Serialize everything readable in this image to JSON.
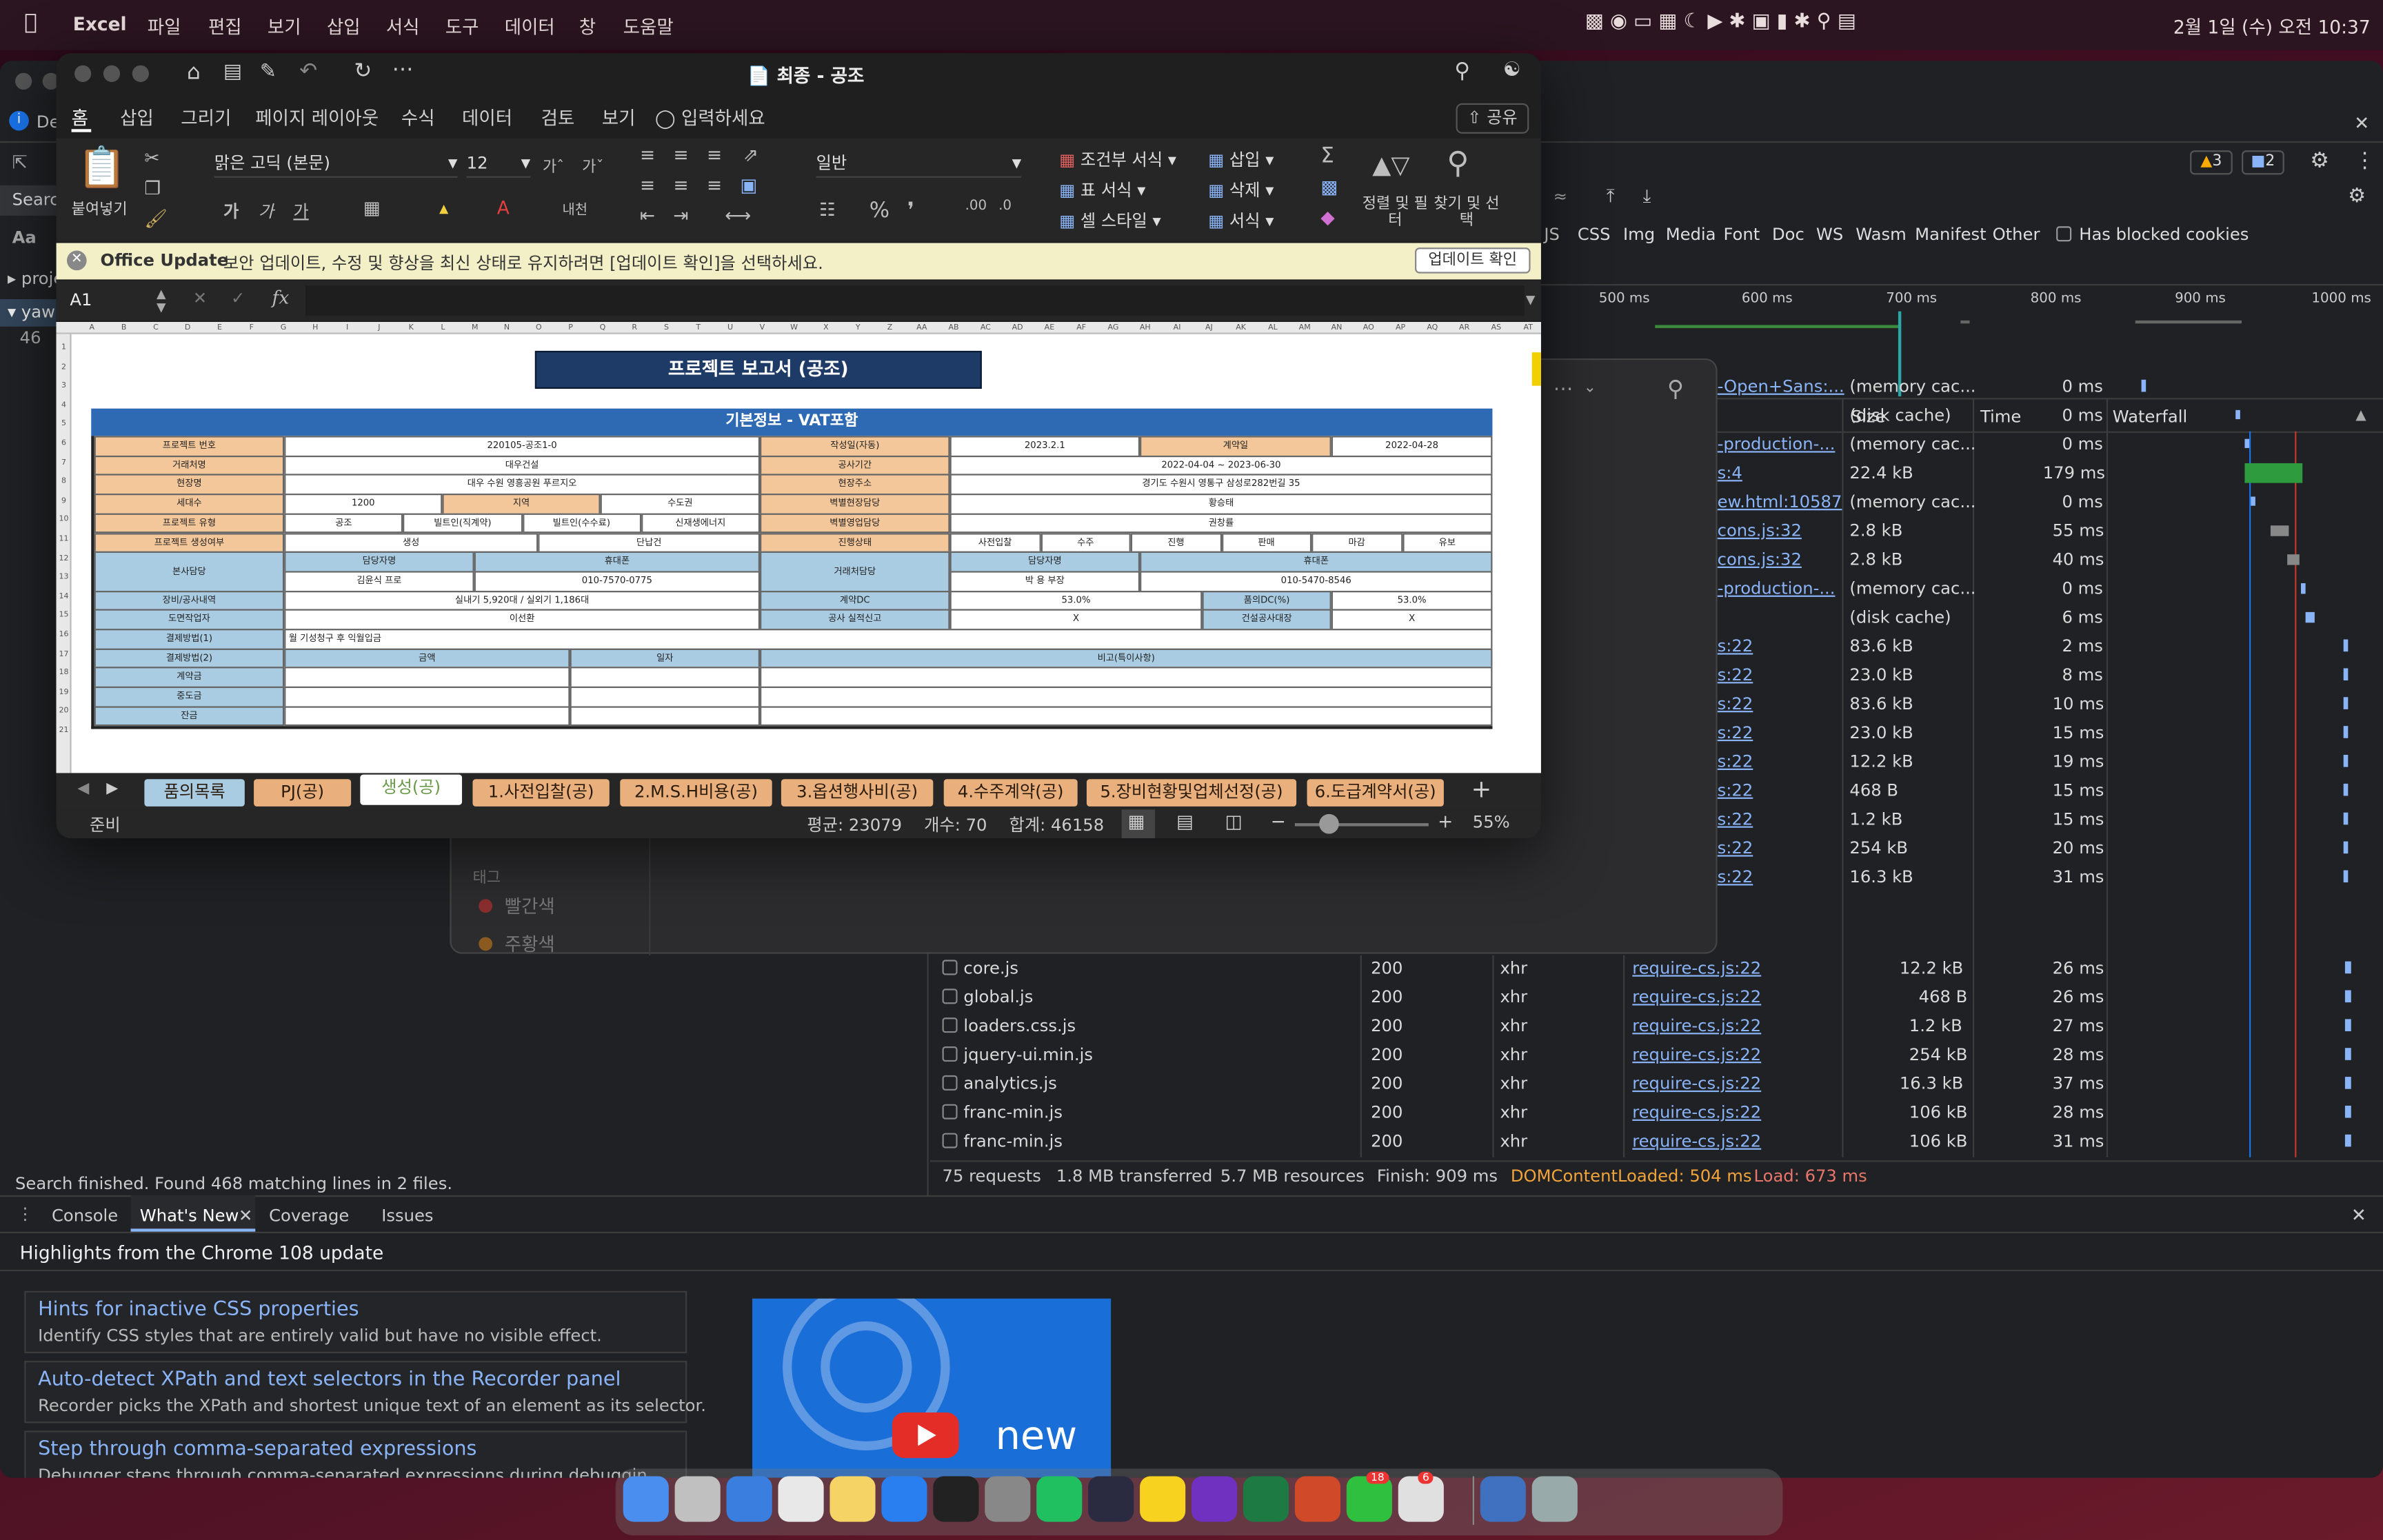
{
  "menubar": {
    "app": "Excel",
    "items": [
      "파일",
      "편집",
      "보기",
      "삽입",
      "서식",
      "도구",
      "데이터",
      "창",
      "도움말"
    ],
    "datetime": "2월 1일 (수) 오전 10:37"
  },
  "excel": {
    "title": "최종 - 공조",
    "share": "공유",
    "ribbon_tabs": [
      "홈",
      "삽입",
      "그리기",
      "페이지 레이아웃",
      "수식",
      "데이터",
      "검토",
      "보기"
    ],
    "tell_me": "입력하세요",
    "paste": "붙여넣기",
    "font_name": "맑은 고딕 (본문)",
    "font_size": "12",
    "number_format": "일반",
    "cond_format": "조건부 서식",
    "table_format": "표 서식",
    "cell_style": "셀 스타일",
    "insert": "삽입",
    "delete": "삭제",
    "format": "서식",
    "sort_filter": "정렬 및 필터",
    "find_select": "찾기 및 선택",
    "update_label": "Office Update",
    "update_msg": "보안 업데이트, 수정 및 향상을 최신 상태로 유지하려면 [업데이트 확인]을 선택하세요.",
    "update_button": "업데이트 확인",
    "name_box": "A1",
    "fx": "fx",
    "columns": [
      "A",
      "B",
      "C",
      "D",
      "E",
      "F",
      "G",
      "H",
      "I",
      "J",
      "K",
      "L",
      "M",
      "N",
      "O",
      "P",
      "Q",
      "R",
      "S",
      "T",
      "U",
      "V",
      "W",
      "X",
      "Y",
      "Z",
      "AA",
      "AB",
      "AC",
      "AD",
      "AE",
      "AF",
      "AG",
      "AH",
      "AI",
      "AJ",
      "AK",
      "AL",
      "AM",
      "AN",
      "AO",
      "AP",
      "AQ",
      "AR",
      "AS",
      "AT"
    ],
    "rows": [
      "1",
      "2",
      "3",
      "4",
      "5",
      "6",
      "7",
      "8",
      "9",
      "10",
      "11",
      "12",
      "13",
      "14",
      "15",
      "16",
      "17",
      "18",
      "19",
      "20",
      "21"
    ],
    "sheet_tabs": [
      "품의목록",
      "PJ(공)",
      "생성(공)",
      "1.사전입찰(공)",
      "2.M.S.H비용(공)",
      "3.옵션행사비(공)",
      "4.수주계약(공)",
      "5.장비현황및업체선정(공)",
      "6.도급계약서(공)"
    ],
    "status_ready": "준비",
    "status_avg": "평균: 23079",
    "status_count": "개수: 70",
    "status_sum": "합계: 46158",
    "zoom": "55%"
  },
  "report": {
    "title": "프로젝트 보고서 (공조)",
    "section": "기본정보 - VAT포함",
    "project_no_label": "프로젝트 번호",
    "project_no": "220105-공조1-0",
    "created_label": "작성일(자동)",
    "created": "2023.2.1",
    "contract_day_label": "계약일",
    "contract_day": "2022-04-28",
    "client_label": "거래처명",
    "client": "대우건설",
    "period_label": "공사기간",
    "period": "2022-04-04 ~ 2023-06-30",
    "site_label": "현장명",
    "site": "대우 수원 영흥공원 푸르지오",
    "address_label": "현장주소",
    "address": "경기도 수원시 영통구 삼성로282번길 35",
    "units_label": "세대수",
    "units": "1200",
    "region_label": "지역",
    "region": "수도권",
    "site_mgr_label": "벽별현장담당",
    "site_mgr": "황승태",
    "sales_mgr_label": "벽별영업담당",
    "sales_mgr": "권창률",
    "ptype_label": "프로젝트 유형",
    "ptype": [
      "공조",
      "빌트인(직계약)",
      "빌트인(수수료)",
      "신재생에너지"
    ],
    "progress_label": "진행상태",
    "progress": [
      "사전입찰",
      "수주",
      "진행",
      "판매",
      "마감",
      "유보"
    ],
    "pcreate_label": "프로젝트 생성여부",
    "pcreate": [
      "생성",
      "단납건"
    ],
    "hq_label": "본사담당",
    "hq_person_h": "담당자명",
    "hq_phone_h": "휴대폰",
    "hq_person": "김윤식 프로",
    "hq_phone": "010-7570-0775",
    "cl_label": "거래처담당",
    "cl_person_h": "담당자명",
    "cl_phone_h": "휴대폰",
    "cl_person": "박 용 부장",
    "cl_phone": "010-5470-8546",
    "equip_label": "장비/공사내역",
    "equip": "실내기 5,920대 / 실외기 1,186대",
    "dc_label": "계약DC",
    "dc": "53.0%",
    "approve_dc_label": "품의DC(%)",
    "approve_dc": "53.0%",
    "drawing_label": "도면작업자",
    "drawing": "이선환",
    "report_label": "공사 실적신고",
    "report_val": "X",
    "ledger_label": "건설공사대장",
    "ledger_val": "X",
    "pay1_label": "결제방법(1)",
    "pay1": "월 기성청구 후 익월입금",
    "pay2_label": "결제방법(2)",
    "amount_h": "금액",
    "date_h": "일자",
    "memo_h": "비고(특이사항)",
    "pay_rows": [
      "계약금",
      "중도금",
      "잔금"
    ]
  },
  "devtools": {
    "filter_types": [
      "JS",
      "CSS",
      "Img",
      "Media",
      "Font",
      "Doc",
      "WS",
      "Wasm",
      "Manifest",
      "Other"
    ],
    "blocked": "Has blocked cookies",
    "timeline": [
      "500 ms",
      "600 ms",
      "700 ms",
      "800 ms",
      "900 ms",
      "1000 ms"
    ],
    "warn_count": "3",
    "msg_count": "2",
    "search_placeholder": "Searc",
    "left_tree": [
      "proje",
      "yawr"
    ],
    "left_count": "46",
    "headers": {
      "size": "Size",
      "time": "Time",
      "waterfall": "Waterfall"
    },
    "rows_top": [
      {
        "initiator": "-Open+Sans:...",
        "size": "(memory cac...",
        "time": "0 ms"
      },
      {
        "initiator": "",
        "size": "(disk cache)",
        "time": "0 ms"
      },
      {
        "initiator": "-production-...",
        "size": "(memory cac...",
        "time": "0 ms"
      },
      {
        "initiator": "s:4",
        "size": "22.4 kB",
        "time": "179 ms"
      },
      {
        "initiator": "ew.html:10587",
        "size": "(memory cac...",
        "time": "0 ms"
      },
      {
        "initiator": "cons.js:32",
        "size": "2.8 kB",
        "time": "55 ms"
      },
      {
        "initiator": "cons.js:32",
        "size": "2.8 kB",
        "time": "40 ms"
      },
      {
        "initiator": "-production-...",
        "size": "(memory cac...",
        "time": "0 ms"
      },
      {
        "initiator": "",
        "size": "(disk cache)",
        "time": "6 ms"
      },
      {
        "initiator": "s:22",
        "size": "83.6 kB",
        "time": "2 ms"
      },
      {
        "initiator": "s:22",
        "size": "23.0 kB",
        "time": "8 ms"
      },
      {
        "initiator": "s:22",
        "size": "83.6 kB",
        "time": "10 ms"
      },
      {
        "initiator": "s:22",
        "size": "23.0 kB",
        "time": "15 ms"
      },
      {
        "initiator": "s:22",
        "size": "12.2 kB",
        "time": "19 ms"
      },
      {
        "initiator": "s:22",
        "size": "468 B",
        "time": "15 ms"
      },
      {
        "initiator": "s:22",
        "size": "1.2 kB",
        "time": "15 ms"
      },
      {
        "initiator": "s:22",
        "size": "254 kB",
        "time": "20 ms"
      },
      {
        "initiator": "s:22",
        "size": "16.3 kB",
        "time": "31 ms"
      }
    ],
    "rows_full": [
      {
        "name": "core.js",
        "status": "200",
        "type": "xhr",
        "initiator": "require-cs.js:22",
        "size": "12.2 kB",
        "time": "26 ms"
      },
      {
        "name": "global.js",
        "status": "200",
        "type": "xhr",
        "initiator": "require-cs.js:22",
        "size": "468 B",
        "time": "26 ms"
      },
      {
        "name": "loaders.css.js",
        "status": "200",
        "type": "xhr",
        "initiator": "require-cs.js:22",
        "size": "1.2 kB",
        "time": "27 ms"
      },
      {
        "name": "jquery-ui.min.js",
        "status": "200",
        "type": "xhr",
        "initiator": "require-cs.js:22",
        "size": "254 kB",
        "time": "28 ms"
      },
      {
        "name": "analytics.js",
        "status": "200",
        "type": "xhr",
        "initiator": "require-cs.js:22",
        "size": "16.3 kB",
        "time": "37 ms"
      },
      {
        "name": "franc-min.js",
        "status": "200",
        "type": "xhr",
        "initiator": "require-cs.js:22",
        "size": "106 kB",
        "time": "28 ms"
      },
      {
        "name": "franc-min.js",
        "status": "200",
        "type": "xhr",
        "initiator": "require-cs.js:22",
        "size": "106 kB",
        "time": "31 ms"
      }
    ],
    "summary": {
      "requests": "75 requests",
      "transferred": "1.8 MB transferred",
      "resources": "5.7 MB resources",
      "finish": "Finish: 909 ms",
      "dcl": "DOMContentLoaded: 504 ms",
      "load": "Load: 673 ms"
    },
    "search_finished": "Search finished.  Found 468 matching lines in 2 files.",
    "drawer_tabs": [
      "Console",
      "What's New",
      "Coverage",
      "Issues"
    ],
    "whats_new_title": "Highlights from the Chrome 108 update",
    "cards": [
      {
        "title": "Hints for inactive CSS properties",
        "desc": "Identify CSS styles that are entirely valid but have no visible effect."
      },
      {
        "title": "Auto-detect XPath and text selectors in the Recorder panel",
        "desc": "Recorder picks the XPath and shortest unique text of an element as its selector."
      },
      {
        "title": "Step through comma-separated expressions",
        "desc": "Debugger steps through comma-separated expressions during debuggin"
      }
    ],
    "video_text": "new",
    "tags_label": "태그",
    "tags": [
      "빨간색",
      "주황색"
    ]
  },
  "dock": {
    "apps": [
      "Finder",
      "Launchpad",
      "Safari",
      "Chrome",
      "Notes",
      "App Store",
      "Terminal",
      "System Settings",
      "PyCharm",
      "DataGrip",
      "KakaoTalk",
      "PhpStorm",
      "Excel",
      "PowerPoint",
      "Messages",
      "Slack",
      "Preview",
      "Trash"
    ],
    "badges": {
      "messages": "18",
      "slack": "6"
    }
  }
}
